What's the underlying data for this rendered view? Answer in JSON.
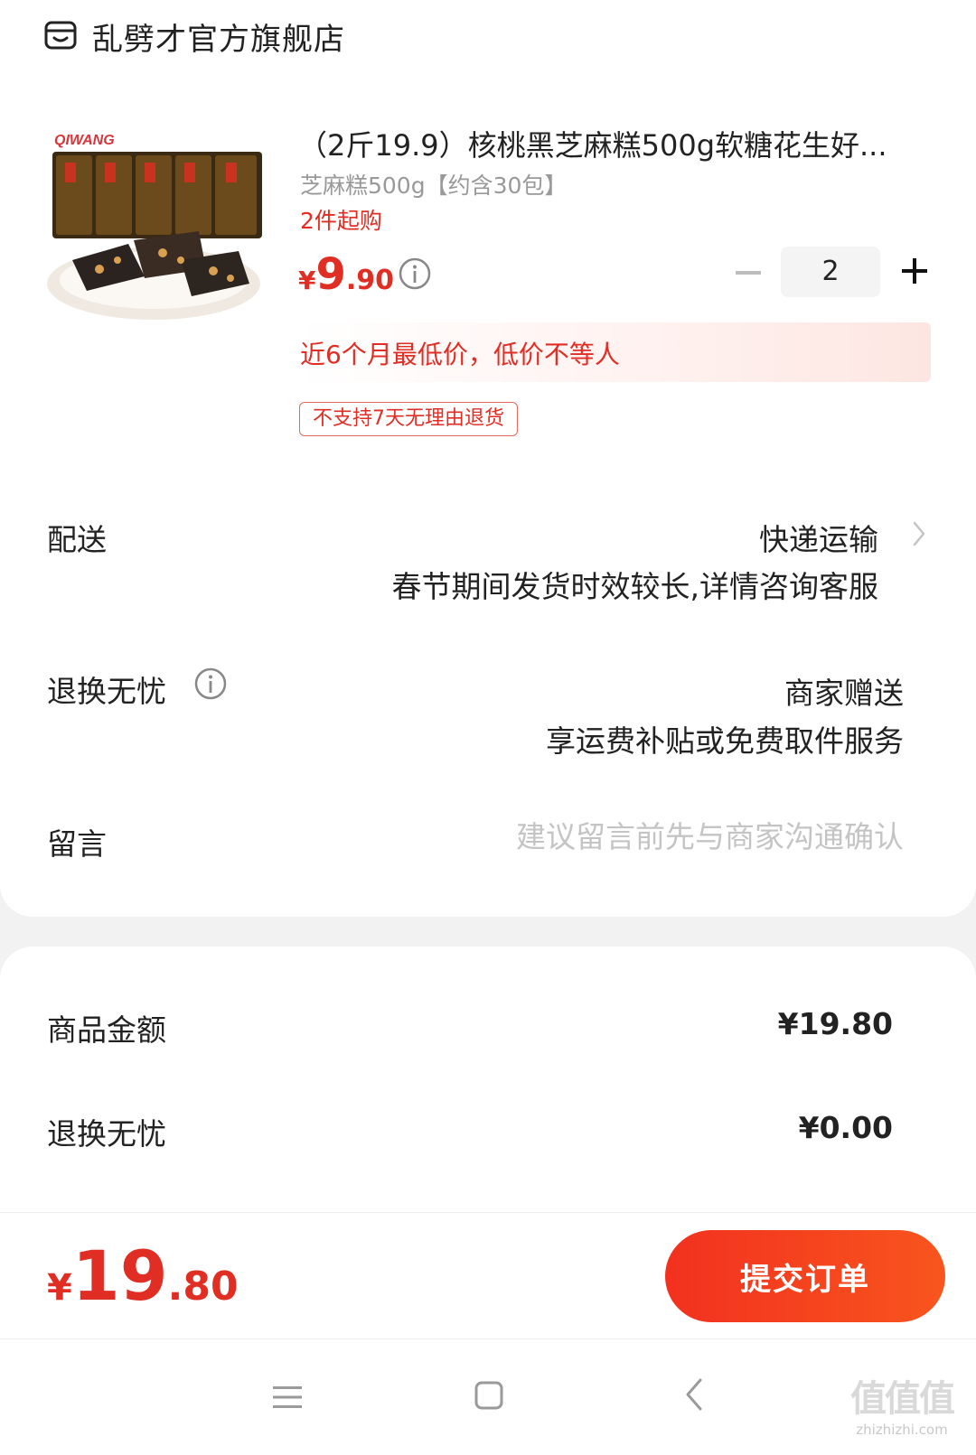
{
  "store": {
    "name": "乱劈才官方旗舰店",
    "icon": "store-icon"
  },
  "product": {
    "image": "product-thumbnail",
    "image_brand_text": "QIWANG",
    "title": "（2斤19.9）核桃黑芝麻糕500g软糖花生好...",
    "spec": "芝麻糕500g【约含30包】",
    "min_buy": "2件起购",
    "price_yen": "¥",
    "price_int": "9",
    "price_dec": ".90",
    "quantity": "2",
    "lowest_price_note": "近6个月最低价，低价不等人",
    "return_tag": "不支持7天无理由退货"
  },
  "shipping": {
    "label": "配送",
    "value": "快递运输",
    "note": "春节期间发货时效较长,详情咨询客服"
  },
  "return_service": {
    "label": "退换无忧",
    "value": "商家赠送",
    "note": "享运费补贴或免费取件服务"
  },
  "message": {
    "label": "留言",
    "placeholder": "建议留言前先与商家沟通确认"
  },
  "summary": {
    "items": [
      {
        "label": "商品金额",
        "value": "¥19.80"
      },
      {
        "label": "退换无忧",
        "value": "¥0.00"
      }
    ]
  },
  "footer": {
    "total_yen": "¥",
    "total_int": "19",
    "total_dec": ".80",
    "submit_label": "提交订单"
  },
  "watermark": {
    "main": "值值值",
    "sub": "zhizhizhi.com"
  },
  "colors": {
    "accent": "#e02e24",
    "button_start": "#f2311f",
    "button_end": "#f8551e"
  }
}
